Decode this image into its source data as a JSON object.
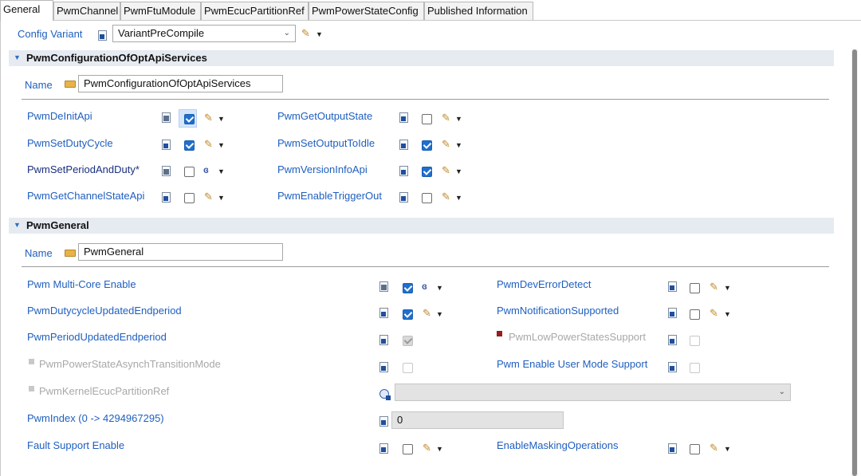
{
  "tabs": [
    {
      "label": "General",
      "active": true
    },
    {
      "label": "PwmChannel",
      "active": false
    },
    {
      "label": "PwmFtuModule",
      "active": false
    },
    {
      "label": "PwmEcucPartitionRef",
      "active": false
    },
    {
      "label": "PwmPowerStateConfig",
      "active": false
    },
    {
      "label": "Published Information",
      "active": false
    }
  ],
  "config_variant": {
    "label": "Config Variant",
    "value": "VariantPreCompile"
  },
  "section1": {
    "title": "PwmConfigurationOfOptApiServices",
    "name_label": "Name",
    "name_value": "PwmConfigurationOfOptApiServices",
    "params": [
      {
        "label": "PwmDeInitApi",
        "checked": true
      },
      {
        "label": "PwmGetOutputState",
        "checked": false
      },
      {
        "label": "PwmSetDutyCycle",
        "checked": true
      },
      {
        "label": "PwmSetOutputToIdle",
        "checked": true
      },
      {
        "label": "PwmSetPeriodAndDuty*",
        "checked": false
      },
      {
        "label": "PwmVersionInfoApi",
        "checked": true
      },
      {
        "label": "PwmGetChannelStateApi",
        "checked": false
      },
      {
        "label": "PwmEnableTriggerOut",
        "checked": false
      }
    ]
  },
  "section2": {
    "title": "PwmGeneral",
    "name_label": "Name",
    "name_value": "PwmGeneral",
    "params": [
      {
        "label": "Pwm Multi-Core Enable",
        "checked": true
      },
      {
        "label": "PwmDevErrorDetect",
        "checked": false
      },
      {
        "label": "PwmDutycycleUpdatedEndperiod",
        "checked": true
      },
      {
        "label": "PwmNotificationSupported",
        "checked": false
      },
      {
        "label": "PwmPeriodUpdatedEndperiod",
        "checked": true
      },
      {
        "label": "PwmLowPowerStatesSupport",
        "checked": false
      },
      {
        "label": "PwmPowerStateAsynchTransitionMode",
        "checked": false
      },
      {
        "label": "Pwm Enable User Mode Support",
        "checked": false
      },
      {
        "label": "PwmKernelEcucPartitionRef",
        "value": ""
      },
      {
        "label": "PwmIndex (0 -> 4294967295)",
        "value": "0"
      },
      {
        "label": "Fault Support Enable",
        "checked": false
      },
      {
        "label": "EnableMaskingOperations",
        "checked": false
      }
    ]
  },
  "icons": {
    "pencil": "pencil-icon",
    "calculator": "calculated-value-icon",
    "dropdown": "chevron-down-icon"
  },
  "colors": {
    "link": "#1f5fbf",
    "section_bar": "#e6ebf2",
    "checkbox_on": "#1f6fcf"
  }
}
